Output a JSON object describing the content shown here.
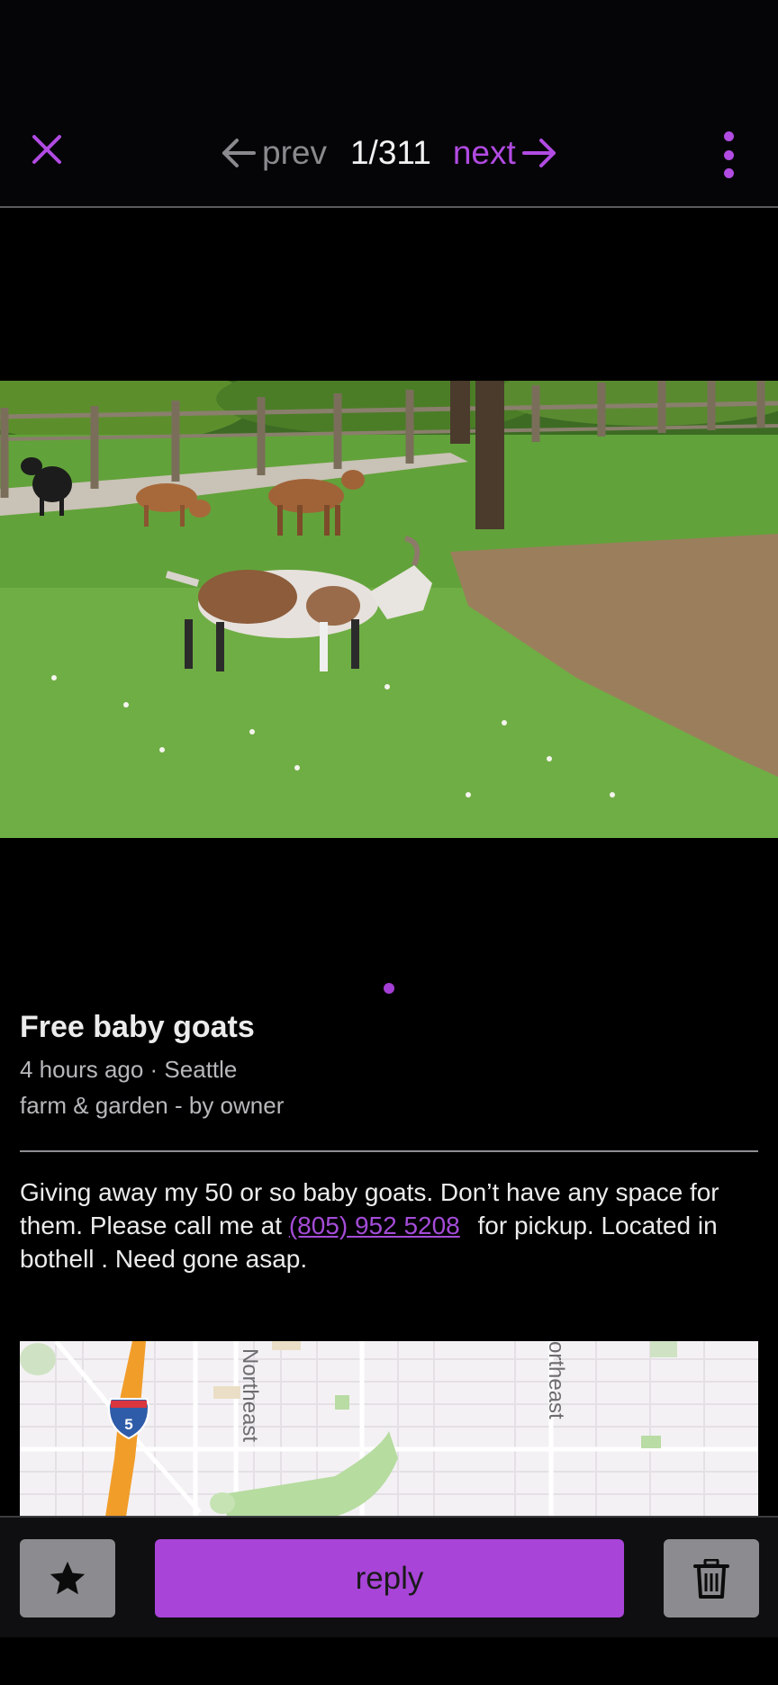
{
  "nav": {
    "prev_label": "prev",
    "counter": "1/311",
    "next_label": "next",
    "accent_color": "#b14be2"
  },
  "listing": {
    "title": "Free baby goats",
    "meta_time_location": "4 hours ago · Seattle",
    "meta_category": "farm & garden - by owner",
    "body_part1": "Giving away my 50 or so baby goats. Don’t have any space for them. Please call me at ",
    "phone": "(805) 952 5208",
    "body_part2": " for pickup. Located in bothell . Need gone asap."
  },
  "map": {
    "highway_shield": "5",
    "street_label_1": "Northeast",
    "street_label_2": "ortheast"
  },
  "actions": {
    "reply_label": "reply",
    "star_icon": "star-icon",
    "trash_icon": "trash-icon"
  }
}
